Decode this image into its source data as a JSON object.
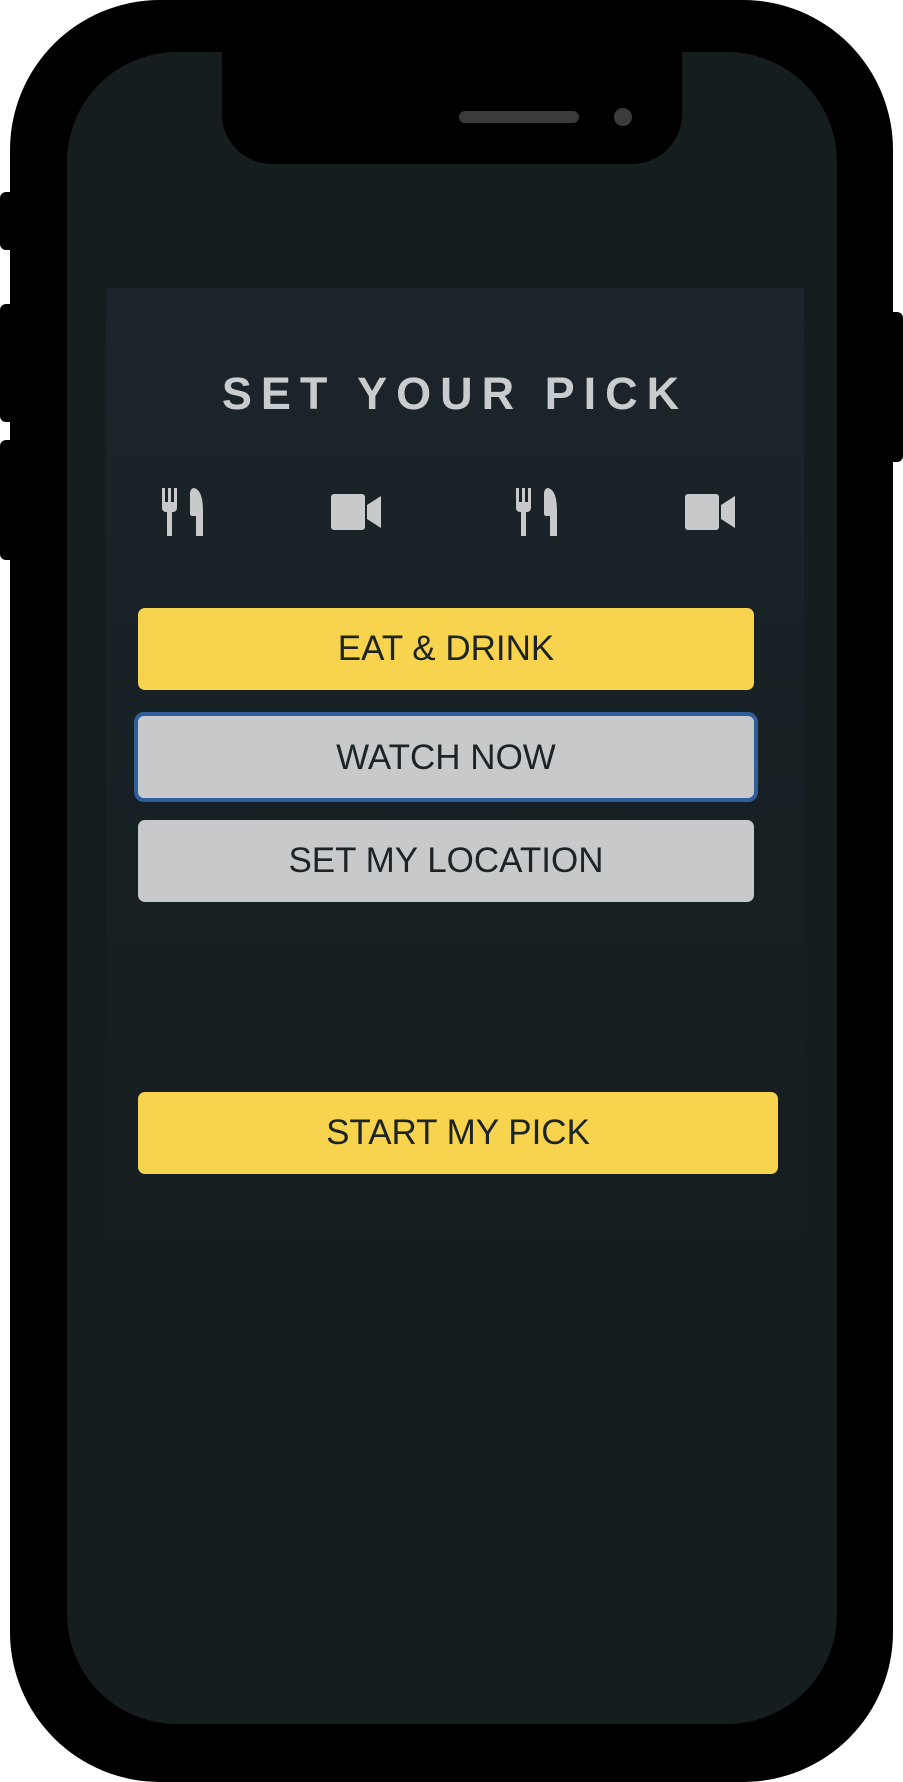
{
  "screen": {
    "title": "SET YOUR PICK"
  },
  "category_icons": [
    "fork-knife-icon",
    "video-camera-icon",
    "fork-knife-icon",
    "video-camera-icon"
  ],
  "options": {
    "eat_drink": "EAT & DRINK",
    "watch_now": "WATCH NOW",
    "set_location": "SET MY LOCATION"
  },
  "actions": {
    "start": "START MY PICK"
  },
  "colors": {
    "accent_yellow": "#f8d34d",
    "button_gray": "#c7c9cb",
    "focus_blue": "#2f5f9a",
    "background": "#161d1f"
  }
}
